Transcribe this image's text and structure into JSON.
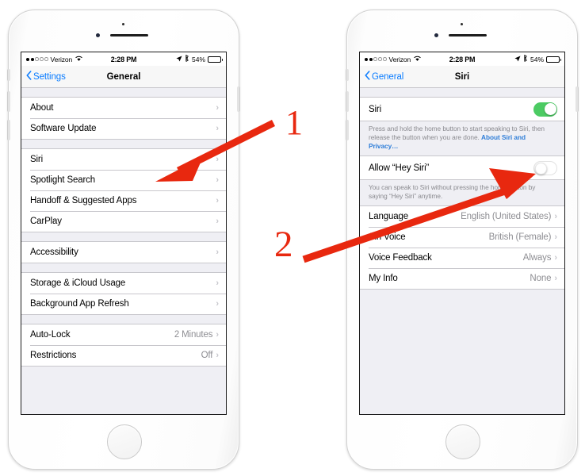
{
  "annotations": {
    "step1_label": "1",
    "step2_label": "2",
    "arrow_color": "#e8280f"
  },
  "colors": {
    "toggle_on": "#4ccb63",
    "link_blue": "#2f7ed8",
    "tint_blue": "#0a7cff",
    "list_bg": "#efeff4",
    "separator": "#c8c7cc",
    "secondary_text": "#8e8e93"
  },
  "status_bar": {
    "signal_filled": 2,
    "signal_hollow": 3,
    "carrier": "Verizon",
    "wifi_icon": "wifi-icon",
    "time": "2:28 PM",
    "location_icon": "location-arrow-icon",
    "bluetooth_icon": "bluetooth-icon",
    "battery_percent": "54%",
    "battery_fill": 54
  },
  "left_phone": {
    "nav": {
      "back_label": "Settings",
      "title": "General",
      "back_icon": "chevron-left-icon"
    },
    "groups": [
      {
        "rows": [
          {
            "label": "About",
            "value": "",
            "accessory": "chevron"
          },
          {
            "label": "Software Update",
            "value": "",
            "accessory": "chevron"
          }
        ]
      },
      {
        "rows": [
          {
            "label": "Siri",
            "value": "",
            "accessory": "chevron"
          },
          {
            "label": "Spotlight Search",
            "value": "",
            "accessory": "chevron"
          },
          {
            "label": "Handoff & Suggested Apps",
            "value": "",
            "accessory": "chevron"
          },
          {
            "label": "CarPlay",
            "value": "",
            "accessory": "chevron"
          }
        ]
      },
      {
        "rows": [
          {
            "label": "Accessibility",
            "value": "",
            "accessory": "chevron"
          }
        ]
      },
      {
        "rows": [
          {
            "label": "Storage & iCloud Usage",
            "value": "",
            "accessory": "chevron"
          },
          {
            "label": "Background App Refresh",
            "value": "",
            "accessory": "chevron"
          }
        ]
      },
      {
        "rows": [
          {
            "label": "Auto-Lock",
            "value": "2 Minutes",
            "accessory": "chevron"
          },
          {
            "label": "Restrictions",
            "value": "Off",
            "accessory": "chevron"
          }
        ]
      }
    ]
  },
  "right_phone": {
    "nav": {
      "back_label": "General",
      "title": "Siri",
      "back_icon": "chevron-left-icon"
    },
    "siri_row": {
      "label": "Siri",
      "toggle": "on"
    },
    "siri_note_text": "Press and hold the home button to start speaking to Siri, then release the button when you are done. ",
    "siri_note_link": "About Siri and Privacy…",
    "hey_siri_row": {
      "label": "Allow “Hey Siri”",
      "toggle": "off"
    },
    "hey_siri_note": "You can speak to Siri without pressing the home button by saying “Hey Siri” anytime.",
    "settings_rows": [
      {
        "label": "Language",
        "value": "English (United States)",
        "accessory": "chevron"
      },
      {
        "label": "Siri Voice",
        "value": "British (Female)",
        "accessory": "chevron"
      },
      {
        "label": "Voice Feedback",
        "value": "Always",
        "accessory": "chevron"
      },
      {
        "label": "My Info",
        "value": "None",
        "accessory": "chevron"
      }
    ]
  }
}
